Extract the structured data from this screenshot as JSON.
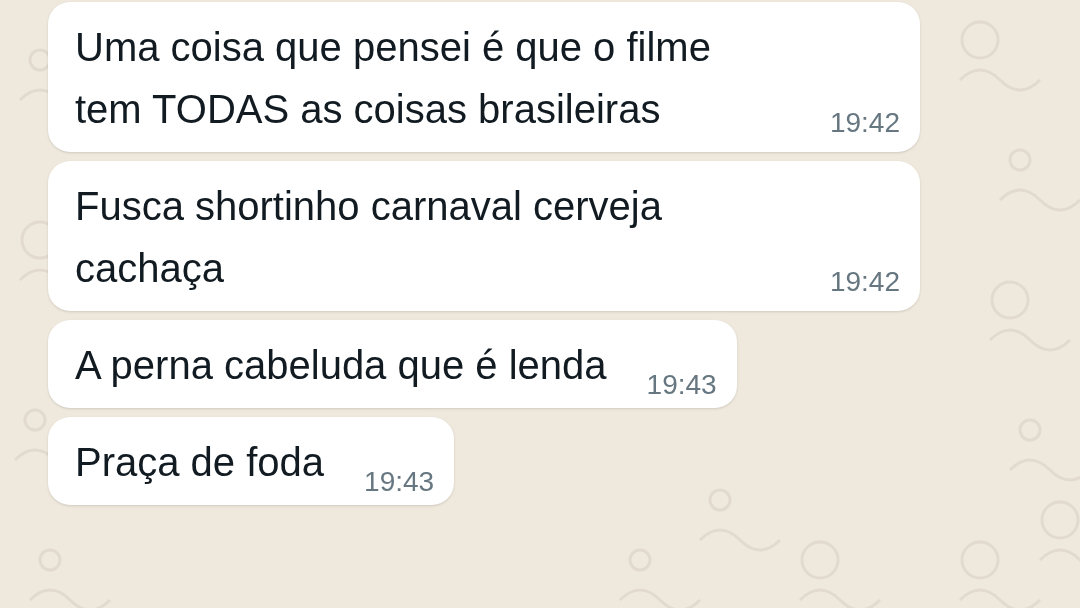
{
  "messages": [
    {
      "lines": [
        "Uma coisa que pensei é que o filme",
        "tem TODAS as coisas brasileiras"
      ],
      "time": "19:42"
    },
    {
      "lines": [
        "Fusca shortinho carnaval cerveja",
        "cachaça"
      ],
      "time": "19:42"
    },
    {
      "lines": [
        "A perna cabeluda que é lenda"
      ],
      "time": "19:43"
    },
    {
      "lines": [
        "Praça de foda"
      ],
      "time": "19:43"
    }
  ]
}
